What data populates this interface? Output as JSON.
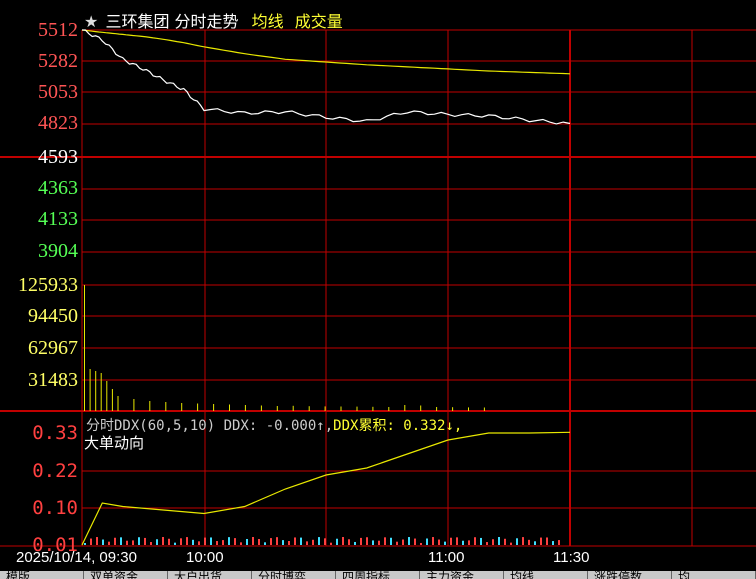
{
  "header": {
    "star": "★",
    "stock_name": "三环集团",
    "chart_kind": "分时走势",
    "avg_line_label": "均线",
    "volume_label": "成交量"
  },
  "price_axis": {
    "labels": [
      "5512",
      "5282",
      "5053",
      "4823",
      "4593",
      "4363",
      "4133",
      "3904"
    ],
    "colors": [
      "#ff5555",
      "#ff5555",
      "#ff5555",
      "#ff5555",
      "#ffffff",
      "#55ff55",
      "#55ff55",
      "#55ff55"
    ]
  },
  "volume_axis": {
    "labels": [
      "125933",
      "94450",
      "62967",
      "31483"
    ]
  },
  "ddx_panel": {
    "header_prefix": "分时DDX(60,5,10) DDX: -0.000↑,",
    "header_cum": "DDX累积: 0.332↓,",
    "subtitle": "大单动向",
    "axis_labels": [
      "0.33",
      "0.22",
      "0.10",
      "0.01"
    ]
  },
  "time_axis": {
    "labels": [
      "2025/10/14, 09:30",
      "10:00",
      "11:00",
      "11:30"
    ]
  },
  "bottom_tabs": [
    "模版",
    "双单资金",
    "大户出货",
    "分时博弈",
    "四周指标",
    "主力资金",
    "均线",
    "涨跌停数",
    "均"
  ],
  "colors": {
    "grid": "#c00000",
    "price_line": "#ffffff",
    "avg_line": "#e8e800",
    "volume_bar": "#e8e800",
    "ddx_line": "#e8e800",
    "ddx_bar_red": "#ff4040",
    "ddx_bar_cyan": "#40e0ff"
  },
  "chart_data": [
    {
      "type": "line",
      "title": "三环集团 分时走势",
      "x": [
        "09:30",
        "09:35",
        "09:40",
        "09:45",
        "09:50",
        "09:55",
        "10:00",
        "10:10",
        "10:20",
        "10:30",
        "10:40",
        "10:50",
        "11:00",
        "11:10",
        "11:20",
        "11:30"
      ],
      "series": [
        {
          "name": "分时走势",
          "values": [
            5512,
            5440,
            5300,
            5230,
            5150,
            5080,
            4940,
            4910,
            4920,
            4880,
            4850,
            4920,
            4900,
            4890,
            4860,
            4835
          ]
        },
        {
          "name": "均线",
          "values": [
            5512,
            5495,
            5480,
            5465,
            5445,
            5420,
            5390,
            5340,
            5300,
            5280,
            5260,
            5245,
            5230,
            5215,
            5205,
            5195
          ]
        }
      ],
      "ylim": [
        3904,
        5512
      ]
    },
    {
      "type": "bar",
      "title": "成交量",
      "values": [
        125933,
        42000,
        40000,
        38000,
        30000,
        22000,
        15000,
        12000,
        10000,
        9000,
        8000,
        7500,
        7000,
        6500,
        6000,
        5500,
        5000,
        5200,
        4800,
        4600,
        4500,
        4400,
        4200,
        4000,
        6000,
        5500,
        4000,
        3800,
        3600,
        3500
      ],
      "ylim": [
        0,
        125933
      ]
    },
    {
      "type": "line",
      "title": "分时DDX",
      "x": [
        "09:30",
        "09:35",
        "09:40",
        "09:50",
        "10:00",
        "10:10",
        "10:20",
        "10:30",
        "10:40",
        "10:50",
        "11:00",
        "11:10",
        "11:20",
        "11:30"
      ],
      "series": [
        {
          "name": "DDX累积",
          "values": [
            0.01,
            0.13,
            0.12,
            0.11,
            0.1,
            0.12,
            0.17,
            0.21,
            0.23,
            0.27,
            0.31,
            0.33,
            0.33,
            0.332
          ]
        }
      ],
      "ylim": [
        0.01,
        0.33
      ]
    }
  ]
}
